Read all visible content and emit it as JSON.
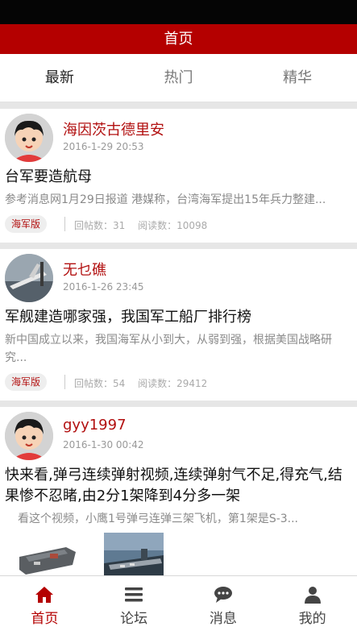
{
  "header": {
    "title": "首页"
  },
  "tabs": [
    {
      "label": "最新",
      "active": true
    },
    {
      "label": "热门",
      "active": false
    },
    {
      "label": "精华",
      "active": false
    }
  ],
  "posts": [
    {
      "username": "海因茨古德里安",
      "date": "2016-1-29 20:53",
      "title": "台军要造航母",
      "excerpt": "参考消息网1月29日报道 港媒称，台湾海军提出15年兵力整建...",
      "tag": "海军版",
      "replies": "回帖数：31",
      "views": "阅读数：10098"
    },
    {
      "username": "无乜礁",
      "date": "2016-1-26 23:45",
      "title": "军舰建造哪家强，我国军工船厂排行榜",
      "excerpt": "新中国成立以来，我国海军从小到大，从弱到强，根据美国战略研究...",
      "tag": "海军版",
      "replies": "回帖数：54",
      "views": "阅读数：29412"
    },
    {
      "username": "gyy1997",
      "date": "2016-1-30 00:42",
      "title": "快来看,弹弓连续弹射视频,连续弹射气不足,得充气,结果惨不忍睹,由2分1架降到4分多一架",
      "excerpt": "看这个视频，小鹰1号弹弓连弹三架飞机，第1架是S-3..."
    }
  ],
  "bottom_nav": [
    {
      "label": "首页",
      "icon": "home-icon",
      "active": true
    },
    {
      "label": "论坛",
      "icon": "list-icon",
      "active": false
    },
    {
      "label": "消息",
      "icon": "chat-icon",
      "active": false
    },
    {
      "label": "我的",
      "icon": "user-icon",
      "active": false
    }
  ],
  "colors": {
    "brand": "#b40000",
    "username": "#b21010",
    "separator": "#e6e6e6"
  }
}
